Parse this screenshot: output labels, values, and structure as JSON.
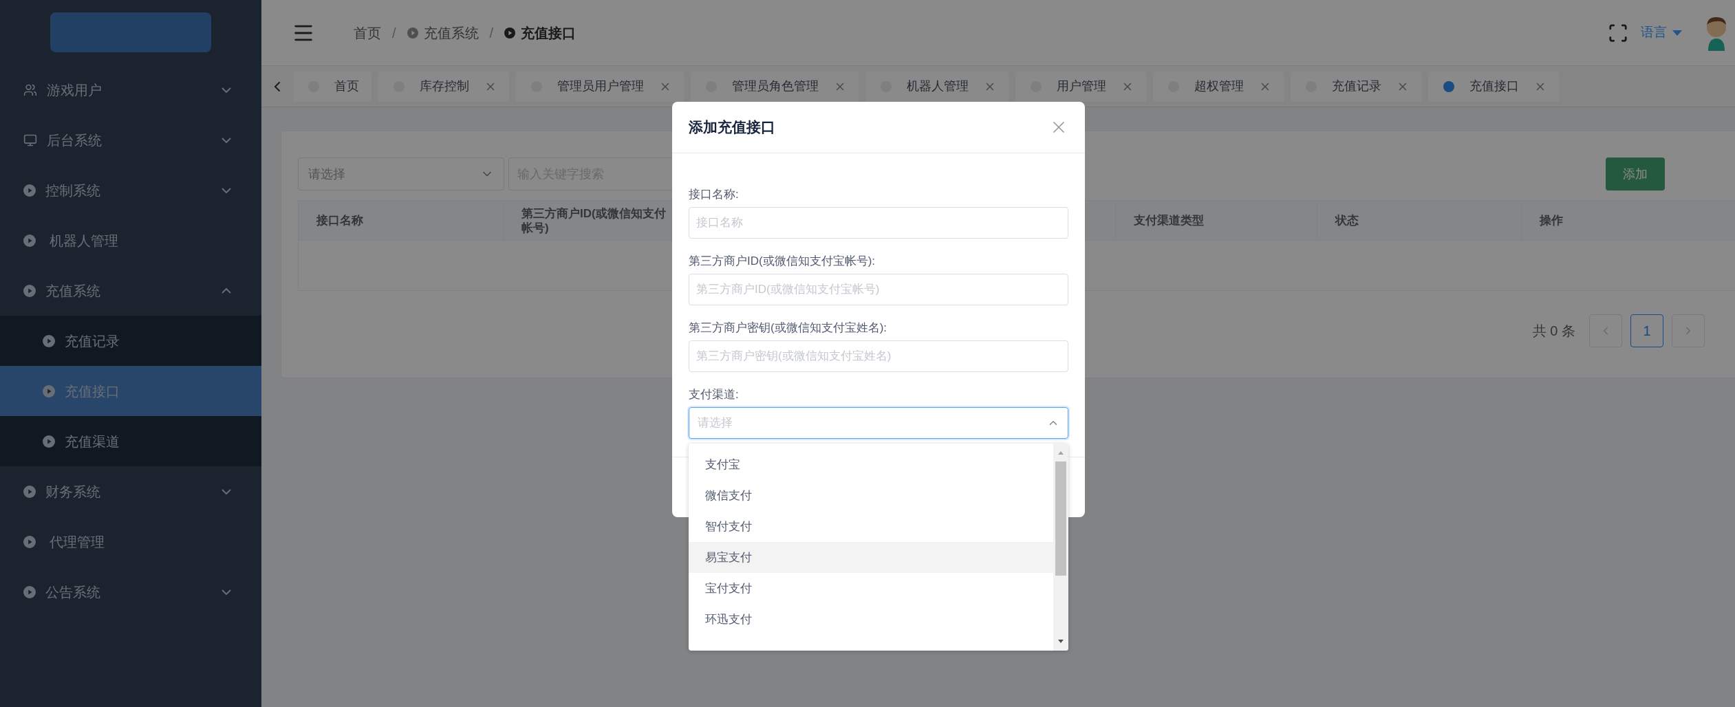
{
  "sidebar": {
    "items": [
      {
        "label": "游戏用户",
        "kind": "group",
        "expanded": false
      },
      {
        "label": "后台系统",
        "kind": "group",
        "expanded": false
      },
      {
        "label": "控制系统",
        "kind": "group",
        "expanded": false
      },
      {
        "label": "机器人管理",
        "kind": "leaf"
      },
      {
        "label": "充值系统",
        "kind": "group",
        "expanded": true,
        "children": [
          {
            "label": "充值记录",
            "selected": false
          },
          {
            "label": "充值接口",
            "selected": true
          },
          {
            "label": "充值渠道",
            "selected": false
          }
        ]
      },
      {
        "label": "财务系统",
        "kind": "group",
        "expanded": false
      },
      {
        "label": "代理管理",
        "kind": "leaf"
      },
      {
        "label": "公告系统",
        "kind": "group",
        "expanded": false
      }
    ]
  },
  "header": {
    "breadcrumb": [
      {
        "label": "首页",
        "current": false
      },
      {
        "label": "充值系统",
        "current": false
      },
      {
        "label": "充值接口",
        "current": true
      }
    ],
    "separator": "/",
    "language": "语言"
  },
  "tabs": [
    {
      "label": "首页",
      "closable": false,
      "selected": false
    },
    {
      "label": "库存控制",
      "closable": true,
      "selected": false
    },
    {
      "label": "管理员用户管理",
      "closable": true,
      "selected": false
    },
    {
      "label": "管理员角色管理",
      "closable": true,
      "selected": false
    },
    {
      "label": "机器人管理",
      "closable": true,
      "selected": false
    },
    {
      "label": "用户管理",
      "closable": true,
      "selected": false
    },
    {
      "label": "超权管理",
      "closable": true,
      "selected": false
    },
    {
      "label": "充值记录",
      "closable": true,
      "selected": false
    },
    {
      "label": "充值接口",
      "closable": true,
      "selected": true
    }
  ],
  "filters": {
    "select_placeholder": "请选择",
    "search_placeholder": "输入关键字搜索"
  },
  "add_button": "添加",
  "table": {
    "columns": [
      {
        "lines": [
          "接口名称"
        ]
      },
      {
        "lines": [
          "第三方商户ID(或微信知支付",
          "帐号)"
        ]
      },
      {
        "lines": [
          "支付渠道类型"
        ]
      },
      {
        "lines": [
          "状态"
        ]
      },
      {
        "lines": [
          "操作"
        ]
      }
    ]
  },
  "pagination": {
    "total": "共 0 条",
    "pages": [
      {
        "label": "1",
        "selected": true
      }
    ]
  },
  "dialog": {
    "title": "添加充值接口",
    "fields": [
      {
        "label": "接口名称:",
        "placeholder": "接口名称",
        "kind": "input"
      },
      {
        "label": "第三方商户ID(或微信知支付宝帐号):",
        "placeholder": "第三方商户ID(或微信知支付宝帐号)",
        "kind": "input"
      },
      {
        "label": "第三方商户密钥(或微信知支付宝姓名):",
        "placeholder": "第三方商户密钥(或微信知支付宝姓名)",
        "kind": "input"
      },
      {
        "label": "支付渠道:",
        "placeholder": "请选择",
        "kind": "select",
        "expanded": true
      }
    ],
    "options": [
      {
        "label": "支付宝",
        "highlighted": false
      },
      {
        "label": "微信支付",
        "highlighted": false
      },
      {
        "label": "智付支付",
        "highlighted": false
      },
      {
        "label": "易宝支付",
        "highlighted": true
      },
      {
        "label": "宝付支付",
        "highlighted": false
      },
      {
        "label": "环迅支付",
        "highlighted": false
      }
    ]
  }
}
